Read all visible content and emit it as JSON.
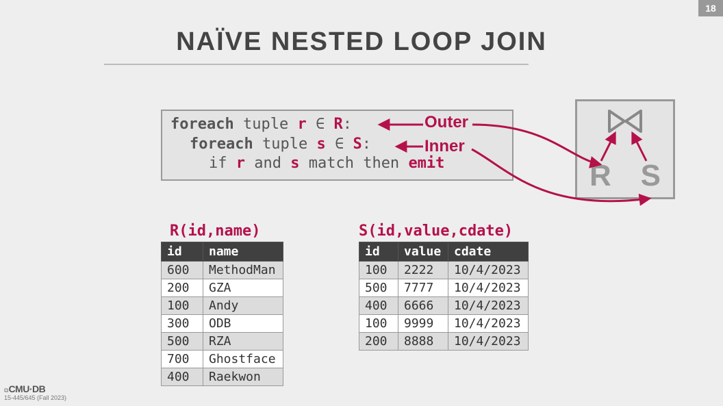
{
  "meta": {
    "page_number": "18",
    "title": "NAÏVE NESTED LOOP JOIN",
    "brand_main": "CMU·DB",
    "brand_sub": "15-445/645 (Fall 2023)"
  },
  "pseudocode": {
    "l1_pre": "foreach ",
    "l1_mid": "tuple ",
    "l1_r": "r",
    "l1_in": " ∈ ",
    "l1_R": "R",
    "l1_post": ":",
    "l2_pre": "foreach ",
    "l2_mid": "tuple ",
    "l2_s": "s",
    "l2_in": " ∈ ",
    "l2_S": "S",
    "l2_post": ":",
    "l3_if": "if ",
    "l3_r": "r",
    "l3_and": " and ",
    "l3_s": "s",
    "l3_mt": " match then ",
    "l3_emit": "emit"
  },
  "labels": {
    "outer": "Outer",
    "inner": "Inner",
    "table_r_header": "R(id,name)",
    "table_s_header": "S(id,value,cdate)",
    "join_left": "R",
    "join_right": "S"
  },
  "table_r": {
    "columns": [
      "id",
      "name"
    ],
    "rows": [
      [
        "600",
        "MethodMan"
      ],
      [
        "200",
        "GZA"
      ],
      [
        "100",
        "Andy"
      ],
      [
        "300",
        "ODB"
      ],
      [
        "500",
        "RZA"
      ],
      [
        "700",
        "Ghostface"
      ],
      [
        "400",
        "Raekwon"
      ]
    ]
  },
  "table_s": {
    "columns": [
      "id",
      "value",
      "cdate"
    ],
    "rows": [
      [
        "100",
        "2222",
        "10/4/2023"
      ],
      [
        "500",
        "7777",
        "10/4/2023"
      ],
      [
        "400",
        "6666",
        "10/4/2023"
      ],
      [
        "100",
        "9999",
        "10/4/2023"
      ],
      [
        "200",
        "8888",
        "10/4/2023"
      ]
    ]
  }
}
